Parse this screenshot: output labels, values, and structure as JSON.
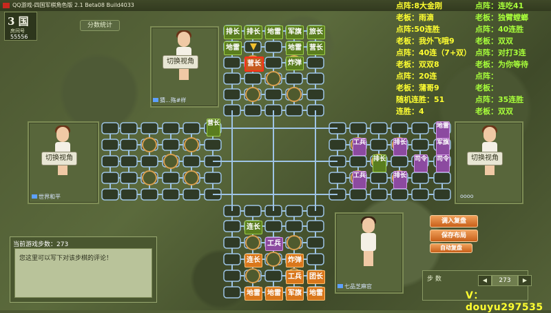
{
  "window": {
    "title": "QQ游戏-四国军棋角色版 2.1 Beta08 Build4033"
  },
  "room": {
    "logo": "3 国",
    "label": "房间号",
    "number": "55556"
  },
  "score_button": "分数统计",
  "players": {
    "top": {
      "switch": "切换视角",
      "name": "猜...殇#样"
    },
    "left": {
      "switch": "切换视角",
      "name": "世界和平"
    },
    "right": {
      "switch": "切换视角",
      "name": "oooo"
    },
    "bottom": {
      "name": "七品芝麻官"
    }
  },
  "stats_yellow": [
    "点阵:8大金刚",
    "老板：雨滴",
    "点阵:50连胜",
    "老板：我外飞哦9",
    "点阵：40连（7+双）",
    "老板：双双8",
    "点阵：20连",
    "老板：蒲哥9",
    "随机连胜：51",
    "连胜：4"
  ],
  "stats_green": [
    "点阵：连吃41",
    "老板：独臂螳螂",
    "点阵：40连胜",
    "老板：双双",
    "点阵：对打3连",
    "老板：为你等待",
    "点阵：",
    "老板：",
    "点阵：35连胜",
    "老板：双双"
  ],
  "buttons": {
    "load_replay": "调入复盘",
    "save_layout": "保存布局",
    "auto_replay": "自动复盘"
  },
  "chat": {
    "header": "当前游戏步数：273",
    "placeholder": "您这里可以写下对该步棋的评论！"
  },
  "steps": {
    "label": "步  数",
    "value": "273",
    "prev": "◀",
    "next": "▶"
  },
  "watermark": "V：douyu297535",
  "pieces": {
    "top": [
      "排长",
      "排长",
      "地雷",
      "军旗",
      "旅长",
      "地雷",
      "地雷",
      "营长",
      "营长",
      "炸弹"
    ],
    "bottom": [
      "连长",
      "工兵",
      "连长",
      "炸弹",
      "工兵",
      "团长",
      "地雷",
      "地雷",
      "军旗",
      "地雷"
    ],
    "right": [
      "工兵",
      "排长",
      "排长",
      "司令",
      "工兵",
      "排长",
      "军旗",
      "地雷"
    ],
    "center": [
      "营长"
    ]
  },
  "colors": {
    "green_piece": "#5a7d1f",
    "orange_piece": "#d9771c",
    "purple_piece": "#8c4aa0",
    "stat_yellow": "#ffff30",
    "stat_green": "#a8ff3a"
  }
}
